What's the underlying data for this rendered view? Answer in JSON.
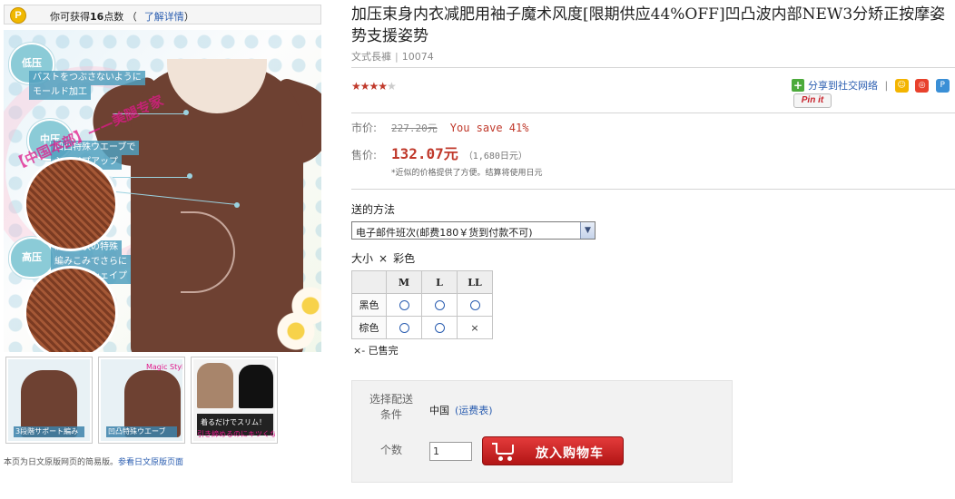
{
  "points": {
    "coin_letter": "P",
    "prefix": "你可获得",
    "count": "16",
    "suffix": "点数 （",
    "link": "了解详情",
    "close": "）"
  },
  "main_image": {
    "hearts": [
      "低压",
      "中压",
      "高压"
    ],
    "callouts": [
      "バストをつぶさないように",
      "モールド加工",
      "凹凸特殊ウエーブで",
      "シェイプアップ",
      "渦巻き状の特殊",
      "編みこみでさらに",
      "ウエストシェイプ"
    ],
    "watermark": "【中国本部】——美腿专家"
  },
  "thumbnails": [
    {
      "label": "3段階サポート編み",
      "alt": "thumbnail-1"
    },
    {
      "label": "凹凸特殊ウエーブ",
      "title": "Magic Style",
      "alt": "thumbnail-2"
    },
    {
      "label": "着るだけでスリム！",
      "bottom": "引き締めるのにキツくない！",
      "alt": "thumbnail-3"
    }
  ],
  "footer": {
    "text": "本页为日文原版网页的简易版。",
    "link": "参看日文原版页面"
  },
  "product": {
    "title": "加压束身内衣减肥用袖子魔术风度[限期供应44%OFF]凹凸波内部NEW3分矫正按摩姿势支援姿势",
    "shop": "文式長褲",
    "id": "10074",
    "rating": 4,
    "rating_max": 5
  },
  "share": {
    "label": "分享到社交网络",
    "divider": "|",
    "icons": [
      "smiley-icon",
      "weibo-icon",
      "p-icon"
    ],
    "pinit": "Pin it"
  },
  "pricing": {
    "list_label": "市价:",
    "list_price": "227.20元",
    "save_text": "You save 41%",
    "sale_label": "售价:",
    "sale_price": "132.07元",
    "yen_price": "（1,680日元）",
    "note": "*近似的价格提供了方便。结算将使用日元"
  },
  "shipping": {
    "label": "送的方法",
    "selected": "电子邮件班次(邮费180￥货到付款不可)"
  },
  "options": {
    "size_label": "大小",
    "times": "×",
    "color_label": "彩色",
    "sizes": [
      "M",
      "L",
      "LL"
    ],
    "rows": [
      {
        "color": "黑色",
        "stock": [
          "○",
          "○",
          "○"
        ]
      },
      {
        "color": "棕色",
        "stock": [
          "○",
          "○",
          "×"
        ]
      }
    ],
    "legend": "×- 已售完"
  },
  "cart": {
    "dest_label_1": "选择配送",
    "dest_label_2": "条件",
    "country": "中国",
    "shipping_table_link": "(运费表)",
    "qty_label": "个数",
    "qty_value": "1",
    "button": "放入购物车"
  },
  "colors": {
    "accent_red": "#c0392b",
    "link_blue": "#2a5db0",
    "button_red": "#d42626"
  }
}
